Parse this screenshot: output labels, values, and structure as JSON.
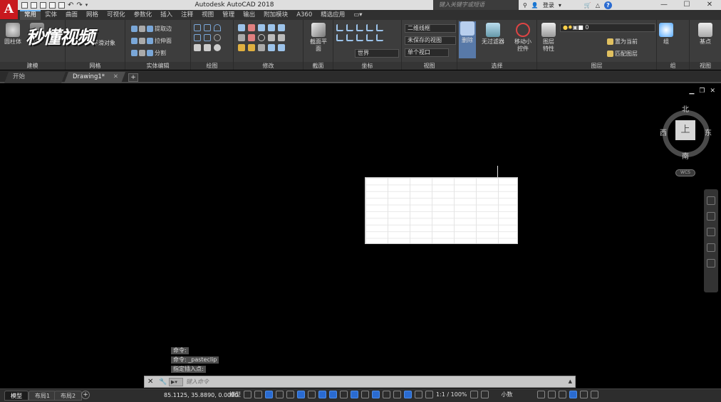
{
  "app": {
    "logo_letter": "A",
    "title": "Autodesk AutoCAD 2018",
    "search_placeholder": "键入关键字或短语",
    "user_label": "登录",
    "help_label": "?"
  },
  "watermark": "秒懂视频",
  "window_controls": {
    "minimize": "—",
    "maximize": "☐",
    "close": "✕"
  },
  "ribbon_tabs": [
    "常用",
    "实体",
    "曲面",
    "网格",
    "可视化",
    "参数化",
    "插入",
    "注释",
    "视图",
    "管理",
    "输出",
    "附加模块",
    "A360",
    "精选应用"
  ],
  "ribbon": {
    "panels": {
      "modeling": "建模",
      "mesh": "网格",
      "solid_edit": "实体编辑",
      "draw": "绘图",
      "modify": "修改",
      "section": "截面",
      "coordinates": "坐标",
      "view": "视图",
      "selection": "选择",
      "layers": "图层",
      "groups": "组",
      "view2": "视图"
    },
    "buttons": {
      "cylinder": "圆柱体",
      "extrude": "拉伸",
      "smooth_object": "平滑对象",
      "extract_edges": "提取边",
      "extrude_faces": "拉伸面",
      "separate": "分割",
      "section_plane": "截面平面",
      "delete": "删除",
      "no_filter": "无过滤器",
      "move_gizmo": "移动小控件",
      "layer_properties": "图层特性",
      "set_current": "置为当前",
      "match_layer": "匹配图层",
      "group": "组",
      "base": "基点"
    },
    "dropdowns": {
      "visual_style": "二维线框",
      "saved_view": "未保存的视图",
      "ucs": "世界",
      "viewport": "单个视口",
      "layer": "0"
    }
  },
  "doc_tabs": [
    {
      "label": "开始"
    },
    {
      "label": "Drawing1*"
    }
  ],
  "doc_tab_add": "+",
  "viewcube": {
    "face": "上",
    "north": "北",
    "south": "南",
    "east": "东",
    "west": "西",
    "wcs": "WCS"
  },
  "command_history": [
    "命令:",
    "命令: _pasteclip",
    "指定插入点:"
  ],
  "command_input_placeholder": "键入命令",
  "layout_tabs": [
    "模型",
    "布局1",
    "布局2"
  ],
  "layout_tab_add": "+",
  "status": {
    "coords": "85.1125, 35.8890, 0.0000",
    "model_label": "模型",
    "scale": "1:1 / 100%",
    "units": "小数"
  }
}
